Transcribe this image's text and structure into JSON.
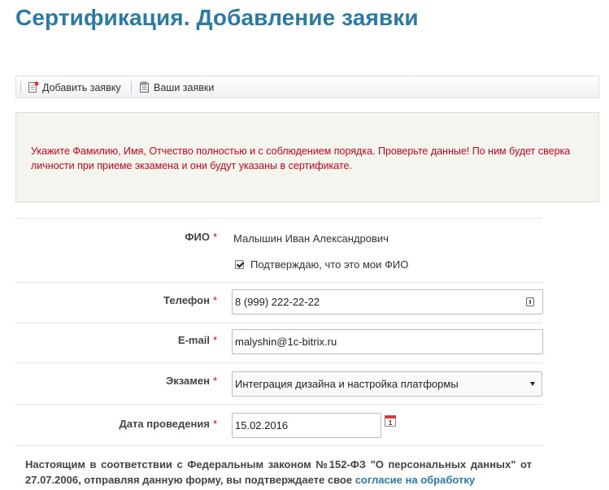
{
  "page": {
    "title": "Сертификация. Добавление заявки"
  },
  "toolbar": {
    "add_label": "Добавить заявку",
    "list_label": "Ваши заявки"
  },
  "alert": {
    "text": "Укажите Фамилию, Имя, Отчество полностью и с соблюдением порядка. Проверьте данные! По ним будет сверка личности при приеме экзамена и они будут указаны в сертификате."
  },
  "form": {
    "required_mark": "*",
    "fio": {
      "label": "ФИО",
      "value": "Малышин Иван Александрович",
      "confirm_label": "Подтверждаю, что это мои ФИО",
      "confirm_checked": true
    },
    "phone": {
      "label": "Телефон",
      "value": "8 (999) 222-22-22"
    },
    "email": {
      "label": "E-mail",
      "value": "malyshin@1c-bitrix.ru"
    },
    "exam": {
      "label": "Экзамен",
      "selected": "Интеграция дизайна и настройка платформы"
    },
    "date": {
      "label": "Дата проведения",
      "value": "15.02.2016",
      "calendar_day": "1"
    }
  },
  "consent": {
    "text": "Настоящим в соответствии с Федеральным законом №152-ФЗ \"О персональных данных\" от 27.07.2006, отправляя данную форму, вы подтверждаете свое ",
    "link_text": "согласие на обработку"
  },
  "icons": {
    "add": "document-add-icon",
    "list": "document-list-icon",
    "calendar": "calendar-icon",
    "phone_field": "contact-card-icon",
    "select": "chevron-down-icon",
    "checkbox": "check-icon"
  },
  "colors": {
    "title": "#2a7aa6",
    "alert_text": "#d0021b",
    "alert_bg": "#f5f5ef",
    "required": "#d0021b",
    "link": "#2a7aa6"
  }
}
